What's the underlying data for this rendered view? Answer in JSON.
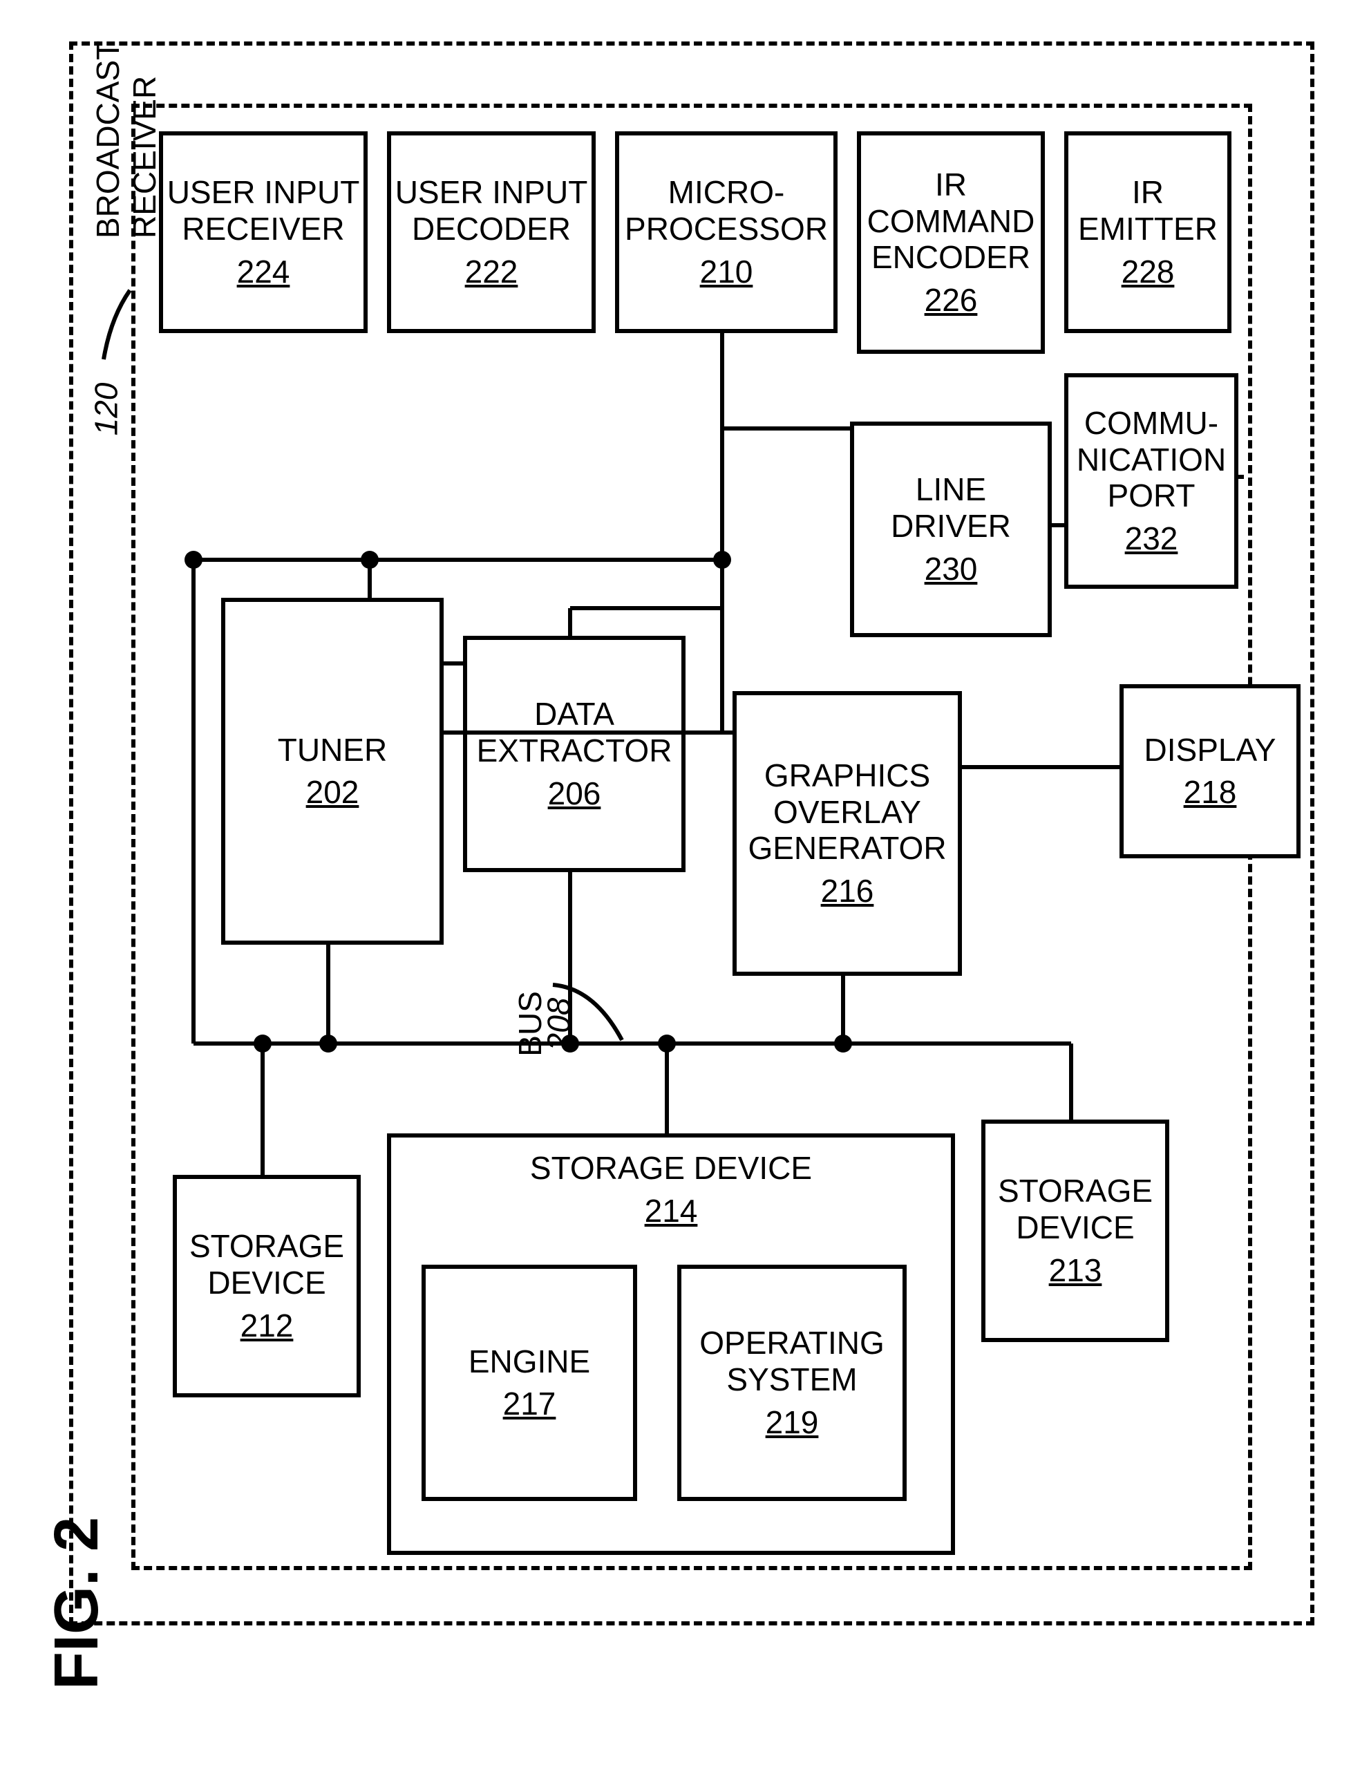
{
  "outerLabel": {
    "line1": "BROADCAST",
    "line2": "RECEIVER",
    "ref": "120"
  },
  "figure": "FIG. 2",
  "busLabel": "BUS",
  "busRef": "208",
  "blocks": {
    "uir": {
      "l1": "USER INPUT",
      "l2": "RECEIVER",
      "ref": "224"
    },
    "uid": {
      "l1": "USER INPUT",
      "l2": "DECODER",
      "ref": "222"
    },
    "mp": {
      "l1": "MICRO-",
      "l2": "PROCESSOR",
      "ref": "210"
    },
    "ice": {
      "l1": "IR",
      "l2": "COMMAND",
      "l3": "ENCODER",
      "ref": "226"
    },
    "ire": {
      "l1": "IR",
      "l2": "EMITTER",
      "ref": "228"
    },
    "ld": {
      "l1": "LINE",
      "l2": "DRIVER",
      "ref": "230"
    },
    "cp": {
      "l1": "COMMU-",
      "l2": "NICATION",
      "l3": "PORT",
      "ref": "232"
    },
    "tun": {
      "l1": "TUNER",
      "ref": "202"
    },
    "de": {
      "l1": "DATA",
      "l2": "EXTRACTOR",
      "ref": "206"
    },
    "gog": {
      "l1": "GRAPHICS",
      "l2": "OVERLAY",
      "l3": "GENERATOR",
      "ref": "216"
    },
    "dsp": {
      "l1": "DISPLAY",
      "ref": "218"
    },
    "s12": {
      "l1": "STORAGE",
      "l2": "DEVICE",
      "ref": "212"
    },
    "s14": {
      "l1": "STORAGE DEVICE",
      "ref": "214"
    },
    "s13": {
      "l1": "STORAGE",
      "l2": "DEVICE",
      "ref": "213"
    },
    "eng": {
      "l1": "ENGINE",
      "ref": "217"
    },
    "os": {
      "l1": "OPERATING",
      "l2": "SYSTEM",
      "ref": "219"
    }
  }
}
